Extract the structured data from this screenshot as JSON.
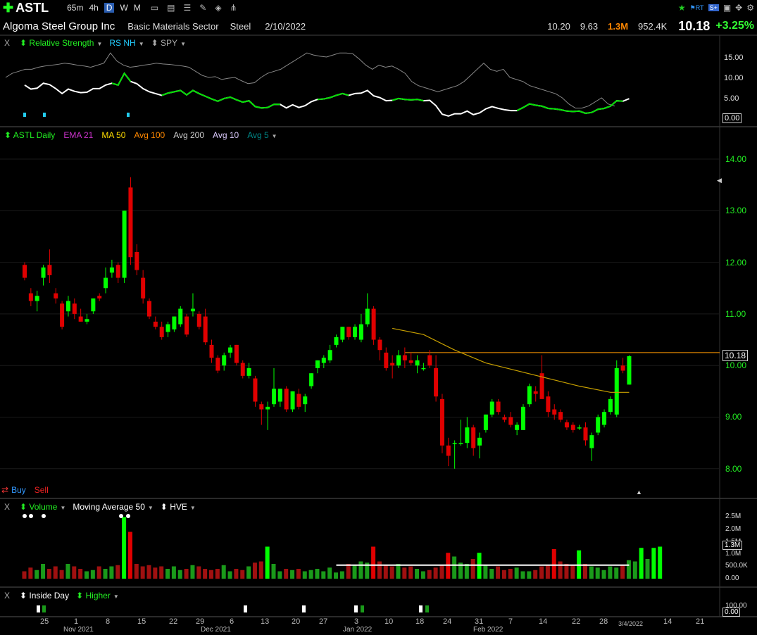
{
  "toolbar": {
    "symbol": "ASTL",
    "timeframes": [
      "65m",
      "4h",
      "D",
      "W",
      "M"
    ],
    "active_timeframe": "D"
  },
  "header": {
    "company": "Algoma Steel Group Inc",
    "sector": "Basic Materials Sector",
    "industry": "Steel",
    "date": "2/10/2022",
    "high": "10.20",
    "low": "9.63",
    "volume": "1.3M",
    "avg_volume": "952.4K",
    "price": "10.18",
    "change": "+3.25%"
  },
  "rs_pane": {
    "close": "X",
    "labels": [
      "Relative Strength",
      "RS NH",
      "SPY"
    ],
    "ticks": [
      "15.00",
      "10.00",
      "5.00",
      "0.00"
    ]
  },
  "price_pane": {
    "labels": [
      "ASTL Daily",
      "EMA 21",
      "MA 50",
      "Avg 100",
      "Avg 200",
      "Avg 10",
      "Avg 5"
    ],
    "ticks": [
      "14.00",
      "13.00",
      "12.00",
      "11.00",
      "10.00",
      "9.00",
      "8.00"
    ],
    "current_price_label": "10.18",
    "buy": "Buy",
    "sell": "Sell"
  },
  "volume_pane": {
    "close": "X",
    "labels": [
      "Volume",
      "Moving Average 50",
      "HVE"
    ],
    "ticks": [
      "2.5M",
      "2.0M",
      "1.5M",
      "1.0M",
      "500.0K",
      "0.00"
    ],
    "current_label": "1.3M"
  },
  "pattern_pane": {
    "close": "X",
    "labels": [
      "Inside Day",
      "Higher"
    ],
    "ticks": [
      "100.00",
      "0.00"
    ]
  },
  "x_axis": {
    "ticks": [
      "25",
      "1",
      "8",
      "15",
      "22",
      "29",
      "6",
      "13",
      "20",
      "27",
      "3",
      "10",
      "18",
      "24",
      "31",
      "7",
      "14",
      "22",
      "28",
      "3/4/2022",
      "14",
      "21"
    ],
    "months": [
      "Nov 2021",
      "Dec 2021",
      "Jan 2022",
      "Feb 2022"
    ]
  },
  "colors": {
    "up": "#00ff00",
    "down": "#e00000",
    "rs_line": "#ffffff",
    "rs_highlight": "#00e000",
    "ma50": "#c8a000",
    "resistance": "#ff9900",
    "accent_orange": "#ff8800",
    "accent_green": "#33ff33"
  },
  "chart_data": {
    "type": "candlestick",
    "candles": [
      {
        "x": 1,
        "o": 11.95,
        "h": 12.0,
        "l": 11.65,
        "c": 11.7
      },
      {
        "x": 2,
        "o": 11.4,
        "h": 11.5,
        "l": 11.15,
        "c": 11.25
      },
      {
        "x": 3,
        "o": 11.25,
        "h": 11.45,
        "l": 11.05,
        "c": 11.35
      },
      {
        "x": 4,
        "o": 11.7,
        "h": 11.95,
        "l": 11.55,
        "c": 11.9
      },
      {
        "x": 5,
        "o": 11.95,
        "h": 12.25,
        "l": 11.6,
        "c": 11.75
      },
      {
        "x": 6,
        "o": 11.4,
        "h": 11.5,
        "l": 11.2,
        "c": 11.3
      },
      {
        "x": 7,
        "o": 11.2,
        "h": 11.25,
        "l": 10.7,
        "c": 10.75
      },
      {
        "x": 8,
        "o": 11.05,
        "h": 11.35,
        "l": 10.95,
        "c": 11.25
      },
      {
        "x": 9,
        "o": 11.2,
        "h": 11.3,
        "l": 10.9,
        "c": 11.0
      },
      {
        "x": 10,
        "o": 10.95,
        "h": 11.1,
        "l": 10.85,
        "c": 10.85
      },
      {
        "x": 11,
        "o": 10.85,
        "h": 11.0,
        "l": 10.8,
        "c": 10.9
      },
      {
        "x": 12,
        "o": 11.05,
        "h": 11.3,
        "l": 11.0,
        "c": 11.3
      },
      {
        "x": 13,
        "o": 11.35,
        "h": 11.4,
        "l": 11.25,
        "c": 11.3
      },
      {
        "x": 14,
        "o": 11.5,
        "h": 11.9,
        "l": 11.4,
        "c": 11.7
      },
      {
        "x": 15,
        "o": 11.8,
        "h": 12.05,
        "l": 11.7,
        "c": 11.9
      },
      {
        "x": 16,
        "o": 11.95,
        "h": 12.0,
        "l": 11.6,
        "c": 11.7
      },
      {
        "x": 17,
        "o": 11.7,
        "h": 13.0,
        "l": 11.6,
        "c": 13.0
      },
      {
        "x": 18,
        "o": 13.45,
        "h": 13.65,
        "l": 11.95,
        "c": 12.1
      },
      {
        "x": 19,
        "o": 12.2,
        "h": 12.35,
        "l": 11.75,
        "c": 11.85
      },
      {
        "x": 20,
        "o": 11.7,
        "h": 11.85,
        "l": 11.2,
        "c": 11.3
      },
      {
        "x": 21,
        "o": 11.25,
        "h": 11.3,
        "l": 10.9,
        "c": 10.95
      },
      {
        "x": 22,
        "o": 10.85,
        "h": 10.95,
        "l": 10.7,
        "c": 10.75
      },
      {
        "x": 23,
        "o": 10.75,
        "h": 10.85,
        "l": 10.5,
        "c": 10.55
      },
      {
        "x": 24,
        "o": 10.65,
        "h": 10.85,
        "l": 10.55,
        "c": 10.8
      },
      {
        "x": 25,
        "o": 10.7,
        "h": 10.95,
        "l": 10.65,
        "c": 10.95
      },
      {
        "x": 26,
        "o": 10.8,
        "h": 11.15,
        "l": 10.75,
        "c": 11.1
      },
      {
        "x": 27,
        "o": 10.95,
        "h": 11.0,
        "l": 10.55,
        "c": 10.6
      },
      {
        "x": 28,
        "o": 11.05,
        "h": 11.4,
        "l": 10.95,
        "c": 11.1
      },
      {
        "x": 29,
        "o": 11.0,
        "h": 11.05,
        "l": 10.7,
        "c": 10.75
      },
      {
        "x": 30,
        "o": 10.95,
        "h": 11.1,
        "l": 10.4,
        "c": 10.45
      },
      {
        "x": 31,
        "o": 10.4,
        "h": 10.5,
        "l": 10.05,
        "c": 10.15
      },
      {
        "x": 32,
        "o": 10.15,
        "h": 10.2,
        "l": 9.85,
        "c": 9.9
      },
      {
        "x": 33,
        "o": 10.0,
        "h": 10.25,
        "l": 9.9,
        "c": 10.2
      },
      {
        "x": 34,
        "o": 10.25,
        "h": 10.4,
        "l": 10.15,
        "c": 10.35
      },
      {
        "x": 35,
        "o": 10.4,
        "h": 10.4,
        "l": 10.0,
        "c": 10.05
      },
      {
        "x": 36,
        "o": 10.05,
        "h": 10.1,
        "l": 9.75,
        "c": 9.8
      },
      {
        "x": 37,
        "o": 9.8,
        "h": 10.05,
        "l": 9.75,
        "c": 9.95
      },
      {
        "x": 38,
        "o": 9.75,
        "h": 9.8,
        "l": 9.2,
        "c": 9.3
      },
      {
        "x": 39,
        "o": 9.25,
        "h": 9.3,
        "l": 8.85,
        "c": 9.15
      },
      {
        "x": 40,
        "o": 9.15,
        "h": 9.3,
        "l": 8.75,
        "c": 9.2
      },
      {
        "x": 41,
        "o": 9.25,
        "h": 9.95,
        "l": 9.2,
        "c": 9.55
      },
      {
        "x": 42,
        "o": 9.3,
        "h": 9.55,
        "l": 9.2,
        "c": 9.55
      },
      {
        "x": 43,
        "o": 9.55,
        "h": 9.6,
        "l": 9.1,
        "c": 9.15
      },
      {
        "x": 44,
        "o": 9.15,
        "h": 9.5,
        "l": 9.1,
        "c": 9.5
      },
      {
        "x": 45,
        "o": 9.45,
        "h": 9.55,
        "l": 9.15,
        "c": 9.2
      },
      {
        "x": 46,
        "o": 9.25,
        "h": 9.45,
        "l": 9.1,
        "c": 9.4
      },
      {
        "x": 47,
        "o": 9.6,
        "h": 9.85,
        "l": 9.55,
        "c": 9.85
      },
      {
        "x": 48,
        "o": 9.95,
        "h": 10.1,
        "l": 9.85,
        "c": 10.1
      },
      {
        "x": 49,
        "o": 10.05,
        "h": 10.2,
        "l": 9.95,
        "c": 10.15
      },
      {
        "x": 50,
        "o": 10.1,
        "h": 10.4,
        "l": 10.05,
        "c": 10.3
      },
      {
        "x": 51,
        "o": 10.4,
        "h": 10.6,
        "l": 10.35,
        "c": 10.55
      },
      {
        "x": 52,
        "o": 10.5,
        "h": 10.75,
        "l": 10.45,
        "c": 10.75
      },
      {
        "x": 53,
        "o": 10.75,
        "h": 10.75,
        "l": 10.5,
        "c": 10.55
      },
      {
        "x": 54,
        "o": 10.55,
        "h": 10.8,
        "l": 10.5,
        "c": 10.75
      },
      {
        "x": 55,
        "o": 10.5,
        "h": 11.0,
        "l": 10.45,
        "c": 10.8
      },
      {
        "x": 56,
        "o": 10.8,
        "h": 11.4,
        "l": 10.75,
        "c": 11.1
      },
      {
        "x": 57,
        "o": 11.1,
        "h": 11.15,
        "l": 10.4,
        "c": 10.5
      },
      {
        "x": 58,
        "o": 10.5,
        "h": 10.55,
        "l": 10.1,
        "c": 10.3
      },
      {
        "x": 59,
        "o": 10.25,
        "h": 10.35,
        "l": 9.9,
        "c": 9.95
      },
      {
        "x": 60,
        "o": 10.05,
        "h": 10.2,
        "l": 9.75,
        "c": 10.0
      },
      {
        "x": 61,
        "o": 10.0,
        "h": 10.3,
        "l": 9.95,
        "c": 10.2
      },
      {
        "x": 62,
        "o": 10.2,
        "h": 10.35,
        "l": 9.95,
        "c": 10.1
      },
      {
        "x": 63,
        "o": 10.1,
        "h": 10.25,
        "l": 10.0,
        "c": 10.05
      },
      {
        "x": 64,
        "o": 10.0,
        "h": 10.2,
        "l": 9.85,
        "c": 10.1
      },
      {
        "x": 65,
        "o": 9.95,
        "h": 10.05,
        "l": 9.9,
        "c": 9.95
      },
      {
        "x": 66,
        "o": 10.2,
        "h": 10.3,
        "l": 9.95,
        "c": 10.0
      },
      {
        "x": 67,
        "o": 9.95,
        "h": 10.2,
        "l": 9.3,
        "c": 9.4
      },
      {
        "x": 68,
        "o": 9.35,
        "h": 9.45,
        "l": 8.3,
        "c": 8.45
      },
      {
        "x": 69,
        "o": 8.45,
        "h": 8.6,
        "l": 8.05,
        "c": 8.25
      },
      {
        "x": 70,
        "o": 8.5,
        "h": 8.55,
        "l": 8.0,
        "c": 8.5
      },
      {
        "x": 71,
        "o": 8.5,
        "h": 8.95,
        "l": 8.45,
        "c": 8.5
      },
      {
        "x": 72,
        "o": 8.5,
        "h": 9.0,
        "l": 8.4,
        "c": 8.8
      },
      {
        "x": 73,
        "o": 8.8,
        "h": 8.85,
        "l": 8.25,
        "c": 8.4
      },
      {
        "x": 74,
        "o": 8.45,
        "h": 8.7,
        "l": 8.2,
        "c": 8.6
      },
      {
        "x": 75,
        "o": 8.75,
        "h": 9.05,
        "l": 8.7,
        "c": 9.05
      },
      {
        "x": 76,
        "o": 9.05,
        "h": 9.35,
        "l": 9.0,
        "c": 9.3
      },
      {
        "x": 77,
        "o": 9.3,
        "h": 9.35,
        "l": 9.05,
        "c": 9.1
      },
      {
        "x": 78,
        "o": 9.0,
        "h": 9.05,
        "l": 8.9,
        "c": 8.95
      },
      {
        "x": 79,
        "o": 9.0,
        "h": 9.1,
        "l": 8.8,
        "c": 8.85
      },
      {
        "x": 80,
        "o": 8.75,
        "h": 8.9,
        "l": 8.65,
        "c": 8.85
      },
      {
        "x": 81,
        "o": 8.75,
        "h": 9.25,
        "l": 8.75,
        "c": 9.2
      },
      {
        "x": 82,
        "o": 9.25,
        "h": 9.65,
        "l": 9.2,
        "c": 9.6
      },
      {
        "x": 83,
        "o": 9.5,
        "h": 9.6,
        "l": 9.3,
        "c": 9.45
      },
      {
        "x": 84,
        "o": 9.85,
        "h": 10.2,
        "l": 9.7,
        "c": 9.35
      },
      {
        "x": 85,
        "o": 9.4,
        "h": 9.5,
        "l": 9.0,
        "c": 9.1
      },
      {
        "x": 86,
        "o": 9.15,
        "h": 9.25,
        "l": 8.95,
        "c": 9.05
      },
      {
        "x": 87,
        "o": 9.1,
        "h": 9.15,
        "l": 8.9,
        "c": 8.95
      },
      {
        "x": 88,
        "o": 8.9,
        "h": 8.95,
        "l": 8.75,
        "c": 8.8
      },
      {
        "x": 89,
        "o": 8.85,
        "h": 8.9,
        "l": 8.7,
        "c": 8.75
      },
      {
        "x": 90,
        "o": 8.8,
        "h": 8.85,
        "l": 8.75,
        "c": 8.8
      },
      {
        "x": 91,
        "o": 8.8,
        "h": 8.9,
        "l": 8.45,
        "c": 8.55
      },
      {
        "x": 92,
        "o": 8.4,
        "h": 8.7,
        "l": 8.15,
        "c": 8.65
      },
      {
        "x": 93,
        "o": 8.7,
        "h": 9.05,
        "l": 8.65,
        "c": 9.0
      },
      {
        "x": 94,
        "o": 8.85,
        "h": 9.15,
        "l": 8.8,
        "c": 9.1
      },
      {
        "x": 95,
        "o": 9.1,
        "h": 9.4,
        "l": 9.05,
        "c": 9.35
      },
      {
        "x": 96,
        "o": 9.05,
        "h": 10.1,
        "l": 9.0,
        "c": 9.95
      },
      {
        "x": 97,
        "o": 10.0,
        "h": 10.15,
        "l": 9.85,
        "c": 9.9
      },
      {
        "x": 98,
        "o": 9.63,
        "h": 10.2,
        "l": 9.63,
        "c": 10.18
      }
    ],
    "ma50": [
      [
        60,
        10.72
      ],
      [
        65,
        10.6
      ],
      [
        70,
        10.3
      ],
      [
        75,
        10.05
      ],
      [
        80,
        9.9
      ],
      [
        85,
        9.75
      ],
      [
        90,
        9.6
      ],
      [
        95,
        9.48
      ],
      [
        98,
        9.48
      ]
    ],
    "resistance": 10.25,
    "volume": [
      0.3,
      0.45,
      0.35,
      0.6,
      0.4,
      0.5,
      0.35,
      0.6,
      0.5,
      0.4,
      0.3,
      0.35,
      0.5,
      0.4,
      0.5,
      0.55,
      2.5,
      1.9,
      0.6,
      0.5,
      0.55,
      0.45,
      0.5,
      0.4,
      0.5,
      0.35,
      0.4,
      0.55,
      0.5,
      0.4,
      0.35,
      0.4,
      0.55,
      0.3,
      0.4,
      0.35,
      0.5,
      0.65,
      0.7,
      1.3,
      0.6,
      0.3,
      0.4,
      0.35,
      0.4,
      0.3,
      0.35,
      0.4,
      0.3,
      0.45,
      0.25,
      0.3,
      0.6,
      0.55,
      0.7,
      0.65,
      1.3,
      0.7,
      0.55,
      0.5,
      0.6,
      0.45,
      0.5,
      0.4,
      0.3,
      0.35,
      0.45,
      0.55,
      1.05,
      0.9,
      0.65,
      0.6,
      0.8,
      1.05,
      0.55,
      0.4,
      0.5,
      0.35,
      0.4,
      0.45,
      0.3,
      0.3,
      0.35,
      0.5,
      0.55,
      1.2,
      0.7,
      0.6,
      0.55,
      1.15,
      0.6,
      0.5,
      0.45,
      0.35,
      0.5,
      0.45,
      0.55,
      0.75,
      0.7,
      1.25,
      0.8,
      1.25,
      1.3
    ],
    "volume_ma": 0.55,
    "rs_line": [
      10,
      11,
      11.5,
      12,
      12,
      12.5,
      12.8,
      13,
      13.2,
      13.5,
      13.3,
      13,
      12.8,
      12.5,
      13,
      13.5,
      16,
      14,
      13,
      12.5,
      12.7,
      13,
      13.2,
      13.5,
      13.3,
      13.2,
      13,
      12.8,
      12.5,
      11.5,
      10.5,
      10,
      10.2,
      9.5,
      9.8,
      10,
      9.2,
      8.5,
      8.7,
      10,
      11,
      11.5,
      12,
      13,
      14,
      15,
      16,
      15.5,
      15.2,
      15,
      15.5,
      16,
      16,
      15.8,
      14.5,
      13,
      12,
      13,
      12.5,
      12.8,
      12,
      11,
      9,
      8,
      7.5,
      7,
      6.5,
      7,
      7.5,
      8,
      9,
      10.5,
      12,
      13.5,
      12,
      11.5,
      12,
      10,
      9.5,
      9,
      8,
      7.5,
      7,
      6.5,
      6,
      5,
      3.5,
      2.5,
      2.5,
      3,
      4,
      5,
      3.5,
      3
    ]
  }
}
